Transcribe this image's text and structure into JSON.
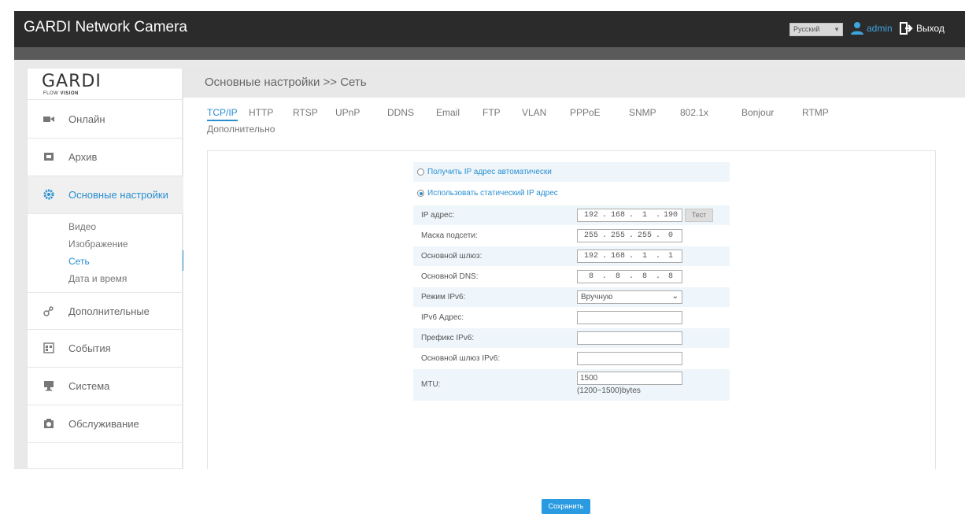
{
  "header": {
    "title": "GARDI Network Camera",
    "language": "Русский",
    "user": "admin",
    "logout": "Выход"
  },
  "logo": {
    "mark": "GARDI",
    "sub_left": "FLOW",
    "sub_right": "VISION"
  },
  "sidebar": {
    "items": [
      {
        "label": "Онлайн",
        "icon": "camera-icon"
      },
      {
        "label": "Архив",
        "icon": "film-icon"
      },
      {
        "label": "Основные настройки",
        "icon": "gear-icon"
      },
      {
        "label": "Дополнительные",
        "icon": "nodes-icon"
      },
      {
        "label": "События",
        "icon": "calendar-icon"
      },
      {
        "label": "Система",
        "icon": "monitor-icon"
      },
      {
        "label": "Обслуживание",
        "icon": "maintenance-icon"
      }
    ],
    "subitems": [
      "Видео",
      "Изображение",
      "Сеть",
      "Дата и время"
    ]
  },
  "breadcrumb": "Основные настройки >> Сеть",
  "tabs": [
    "TCP/IP",
    "HTTP",
    "RTSP",
    "UPnP",
    "DDNS",
    "Email",
    "FTP",
    "VLAN",
    "PPPoE",
    "SNMP",
    "802.1x",
    "Bonjour",
    "RTMP",
    "Дополнительно"
  ],
  "form": {
    "radio_auto": "Получить IP адрес автоматически",
    "radio_static": "Использовать статический IP адрес",
    "ip_label": "IP адрес:",
    "ip": [
      "192",
      "168",
      "1",
      "190"
    ],
    "test_label": "Тест",
    "mask_label": "Маска подсети:",
    "mask": [
      "255",
      "255",
      "255",
      "0"
    ],
    "gateway_label": "Основной шлюз:",
    "gateway": [
      "192",
      "168",
      "1",
      "1"
    ],
    "dns_label": "Основной DNS:",
    "dns": [
      "8",
      "8",
      "8",
      "8"
    ],
    "ipv6_mode_label": "Режим IPv6:",
    "ipv6_mode_value": "Вручную",
    "ipv6_addr_label": "IPv6 Адрес:",
    "ipv6_prefix_label": "Префикс IPv6:",
    "ipv6_gateway_label": "Основной шлюз IPv6:",
    "mtu_label": "MTU:",
    "mtu_value": "1500",
    "mtu_hint": "(1200~1500)bytes",
    "save_label": "Сохранить"
  },
  "colors": {
    "accent": "#2a8fd0",
    "topbar": "#2b2b2b",
    "row_highlight": "#eef6fb"
  }
}
